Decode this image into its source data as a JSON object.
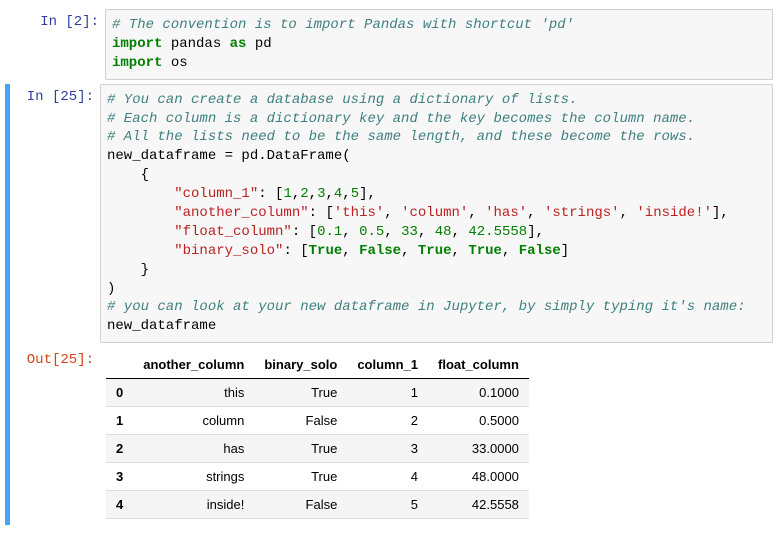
{
  "cell1": {
    "prompt": "In [2]:",
    "code": {
      "line1_comment": "# The convention is to import Pandas with shortcut 'pd'",
      "line2_kw1": "import",
      "line2_mid": " pandas ",
      "line2_kw2": "as",
      "line2_end": " pd",
      "line3_kw": "import",
      "line3_end": " os"
    }
  },
  "cell2": {
    "prompt_in": "In [25]:",
    "prompt_out": "Out[25]:",
    "code": {
      "c1": "# You can create a database using a dictionary of lists.",
      "c2": "# Each column is a dictionary key and the key becomes the column name.",
      "c3": "# All the lists need to be the same length, and these become the rows.",
      "l4": "new_dataframe = pd.DataFrame(",
      "l5": "    {",
      "l6_a": "        ",
      "l6_s": "\"column_1\"",
      "l6_b": ": [",
      "l6_n1": "1",
      "l6_c1": ",",
      "l6_n2": "2",
      "l6_c2": ",",
      "l6_n3": "3",
      "l6_c3": ",",
      "l6_n4": "4",
      "l6_c4": ",",
      "l6_n5": "5",
      "l6_e": "],",
      "l7_a": "        ",
      "l7_s": "\"another_column\"",
      "l7_b": ": [",
      "l7_v1": "'this'",
      "l7_c1": ", ",
      "l7_v2": "'column'",
      "l7_c2": ", ",
      "l7_v3": "'has'",
      "l7_c3": ", ",
      "l7_v4": "'strings'",
      "l7_c4": ", ",
      "l7_v5": "'inside!'",
      "l7_e": "],",
      "l8_a": "        ",
      "l8_s": "\"float_column\"",
      "l8_b": ": [",
      "l8_n1": "0.1",
      "l8_c1": ", ",
      "l8_n2": "0.5",
      "l8_c2": ", ",
      "l8_n3": "33",
      "l8_c3": ", ",
      "l8_n4": "48",
      "l8_c4": ", ",
      "l8_n5": "42.5558",
      "l8_e": "],",
      "l9_a": "        ",
      "l9_s": "\"binary_solo\"",
      "l9_b": ": [",
      "l9_v1": "True",
      "l9_c1": ", ",
      "l9_v2": "False",
      "l9_c2": ", ",
      "l9_v3": "True",
      "l9_c3": ", ",
      "l9_v4": "True",
      "l9_c4": ", ",
      "l9_v5": "False",
      "l9_e": "]",
      "l10": "    }",
      "l11": ")",
      "c12": "# you can look at your new dataframe in Jupyter, by simply typing it's name:",
      "l13": "new_dataframe"
    },
    "output": {
      "headers": [
        "",
        "another_column",
        "binary_solo",
        "column_1",
        "float_column"
      ],
      "rows": [
        [
          "0",
          "this",
          "True",
          "1",
          "0.1000"
        ],
        [
          "1",
          "column",
          "False",
          "2",
          "0.5000"
        ],
        [
          "2",
          "has",
          "True",
          "3",
          "33.0000"
        ],
        [
          "3",
          "strings",
          "True",
          "4",
          "48.0000"
        ],
        [
          "4",
          "inside!",
          "False",
          "5",
          "42.5558"
        ]
      ]
    }
  }
}
